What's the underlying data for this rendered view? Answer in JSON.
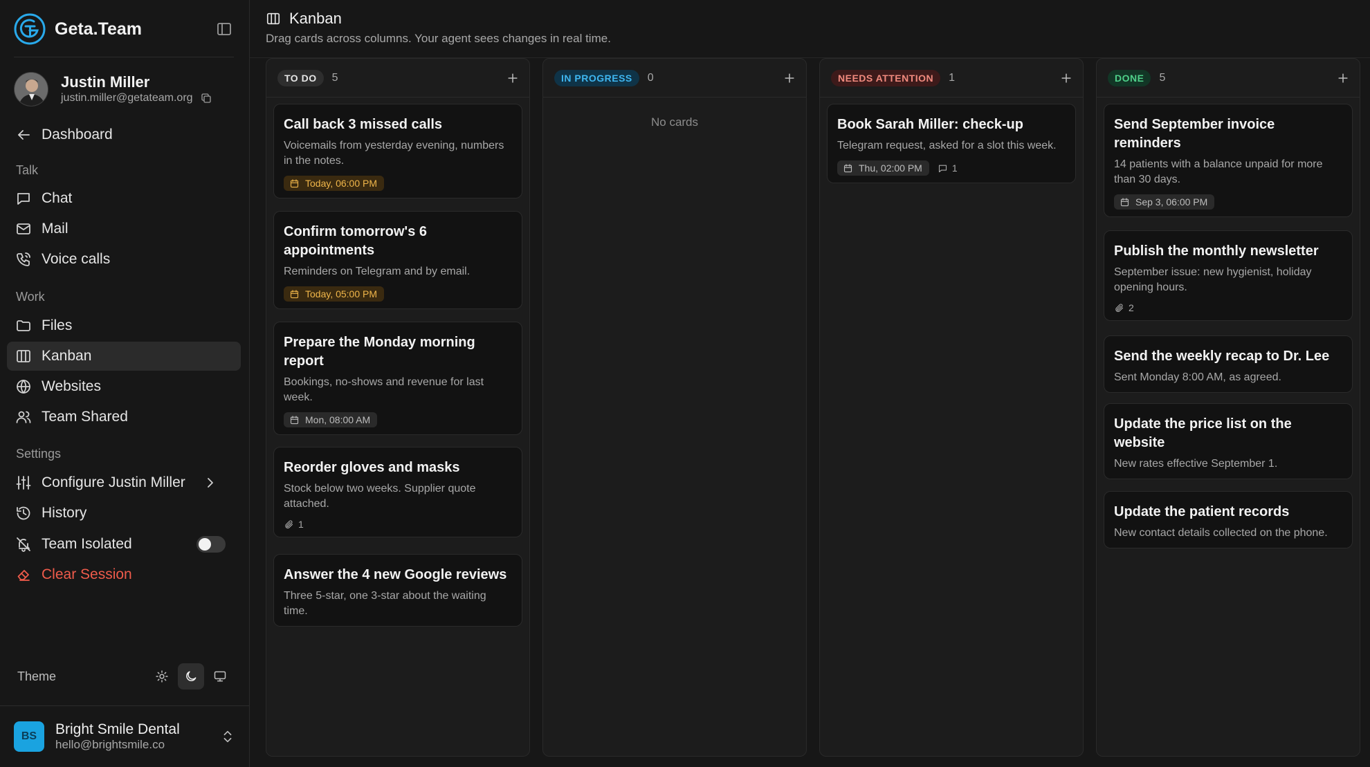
{
  "brand": {
    "name": "Geta.Team"
  },
  "user": {
    "name": "Justin Miller",
    "email": "justin.miller@getateam.org"
  },
  "nav": {
    "dashboard": "Dashboard",
    "talk_label": "Talk",
    "chat": "Chat",
    "mail": "Mail",
    "voice_calls": "Voice calls",
    "work_label": "Work",
    "files": "Files",
    "kanban": "Kanban",
    "websites": "Websites",
    "team_shared": "Team Shared",
    "settings_label": "Settings",
    "configure": "Configure Justin Miller",
    "history": "History",
    "team_isolated": "Team Isolated",
    "team_isolated_on": false,
    "clear_session": "Clear Session"
  },
  "theme": {
    "label": "Theme",
    "active": "dark"
  },
  "workspace": {
    "initials": "BS",
    "name": "Bright Smile Dental",
    "email": "hello@brightsmile.co"
  },
  "header": {
    "title": "Kanban",
    "subtitle": "Drag cards across columns. Your agent sees changes in real time."
  },
  "colors": {
    "todo_badge_bg": "#2e2e2e",
    "todo_badge_fg": "#e6e6e6",
    "progress_badge_bg": "#0f3347",
    "progress_badge_fg": "#3fb6f0",
    "attention_badge_bg": "#3d1a1a",
    "attention_badge_fg": "#f08a7e",
    "done_badge_bg": "#123626",
    "done_badge_fg": "#4fd08a",
    "clear_session": "#ef5b4b",
    "due_today_fg": "#f0b64a"
  },
  "columns": [
    {
      "label": "TO DO",
      "count": "5",
      "cards": [
        {
          "title": "Call back 3 missed calls",
          "desc": "Voicemails from yesterday evening, numbers in the notes.",
          "due": "Today, 06:00 PM",
          "due_today": true
        },
        {
          "title": "Confirm tomorrow's 6 appointments",
          "desc": "Reminders on Telegram and by email.",
          "due": "Today, 05:00 PM",
          "due_today": true
        },
        {
          "title": "Prepare the Monday morning report",
          "desc": "Bookings, no-shows and revenue for last week.",
          "due": "Mon, 08:00 AM",
          "due_today": false
        },
        {
          "title": "Reorder gloves and masks",
          "desc": "Stock below two weeks. Supplier quote attached.",
          "attachments": "1"
        },
        {
          "title": "Answer the 4 new Google reviews",
          "desc": "Three 5-star, one 3-star about the waiting time."
        }
      ]
    },
    {
      "label": "IN PROGRESS",
      "count": "0",
      "empty": "No cards",
      "cards": []
    },
    {
      "label": "NEEDS ATTENTION",
      "count": "1",
      "cards": [
        {
          "title": "Book Sarah Miller: check-up",
          "desc": "Telegram request, asked for a slot this week.",
          "due": "Thu, 02:00 PM",
          "due_today": false,
          "comments": "1"
        }
      ]
    },
    {
      "label": "DONE",
      "count": "5",
      "cards": [
        {
          "title": "Send September invoice reminders",
          "desc": "14 patients with a balance unpaid for more than 30 days.",
          "due": "Sep 3, 06:00 PM",
          "due_today": false
        },
        {
          "title": "Publish the monthly newsletter",
          "desc": "September issue: new hygienist, holiday opening hours.",
          "attachments": "2"
        },
        {
          "title": "Send the weekly recap to Dr. Lee",
          "desc": "Sent Monday 8:00 AM, as agreed."
        },
        {
          "title": "Update the price list on the website",
          "desc": "New rates effective September 1."
        },
        {
          "title": "Update the patient records",
          "desc": "New contact details collected on the phone."
        }
      ]
    }
  ]
}
